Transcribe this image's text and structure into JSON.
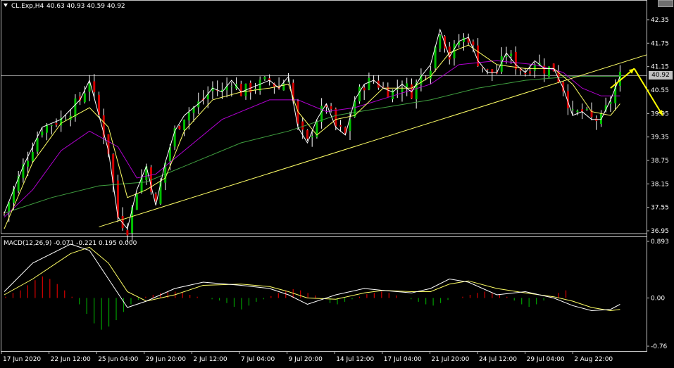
{
  "header": {
    "symbol": "CL.Exp,H4",
    "ohlc": "40.63 40.93 40.59 40.92"
  },
  "current_price_label": "40.92",
  "macd": {
    "label": "MACD(12,26,9)",
    "values": "-0.071 -0.221 0.195 0.000"
  },
  "colors": {
    "bull": "#00c000",
    "bear": "#d40000",
    "wick": "#ffffff",
    "fast_ma": "#ffffff",
    "mid_ma": "#ffff66",
    "slow_ma": "#b000d0",
    "long_ma": "#40a040",
    "trendline": "#ffff66",
    "arrow": "#ffff00",
    "macd_line": "#ffffff",
    "signal_line": "#ffff66",
    "hist_pos": "#d40000",
    "hist_neg": "#00a000"
  },
  "chart_data": [
    {
      "type": "candlestick",
      "title": "CL.Exp,H4",
      "y_ticks": [
        "42.35",
        "41.75",
        "41.15",
        "40.55",
        "39.95",
        "39.35",
        "38.75",
        "38.15",
        "37.55",
        "36.95"
      ],
      "ylim": [
        36.9,
        42.5
      ],
      "x_ticks": [
        "17 Jun 2020",
        "22 Jun 12:00",
        "25 Jun 04:00",
        "29 Jun 20:00",
        "2 Jul 12:00",
        "7 Jul 04:00",
        "9 Jul 20:00",
        "14 Jul 12:00",
        "17 Jul 04:00",
        "21 Jul 20:00",
        "24 Jul 12:00",
        "29 Jul 04:00",
        "2 Aug 22:00"
      ],
      "current_price": 40.92,
      "close_path": [
        [
          0,
          37.4
        ],
        [
          4,
          38.6
        ],
        [
          8,
          39.6
        ],
        [
          12,
          39.8
        ],
        [
          16,
          40.3
        ],
        [
          18,
          40.8
        ],
        [
          20,
          39.9
        ],
        [
          22,
          39.0
        ],
        [
          24,
          37.3
        ],
        [
          26,
          37.0
        ],
        [
          28,
          38.0
        ],
        [
          30,
          38.6
        ],
        [
          32,
          37.6
        ],
        [
          34,
          38.7
        ],
        [
          36,
          39.5
        ],
        [
          38,
          39.9
        ],
        [
          40,
          40.1
        ],
        [
          42,
          40.3
        ],
        [
          44,
          40.6
        ],
        [
          46,
          40.5
        ],
        [
          48,
          40.8
        ],
        [
          50,
          40.5
        ],
        [
          52,
          40.6
        ],
        [
          54,
          40.7
        ],
        [
          56,
          40.8
        ],
        [
          58,
          40.6
        ],
        [
          60,
          40.9
        ],
        [
          62,
          39.6
        ],
        [
          64,
          39.2
        ],
        [
          66,
          39.8
        ],
        [
          68,
          40.2
        ],
        [
          70,
          39.6
        ],
        [
          72,
          39.4
        ],
        [
          74,
          40.3
        ],
        [
          76,
          40.7
        ],
        [
          78,
          40.8
        ],
        [
          80,
          40.6
        ],
        [
          82,
          40.5
        ],
        [
          84,
          40.7
        ],
        [
          86,
          40.5
        ],
        [
          88,
          40.9
        ],
        [
          90,
          41.2
        ],
        [
          92,
          42.1
        ],
        [
          94,
          41.4
        ],
        [
          96,
          41.8
        ],
        [
          98,
          41.9
        ],
        [
          100,
          41.3
        ],
        [
          102,
          41.0
        ],
        [
          104,
          41.0
        ],
        [
          106,
          41.5
        ],
        [
          108,
          41.2
        ],
        [
          110,
          41.0
        ],
        [
          112,
          41.3
        ],
        [
          114,
          41.1
        ],
        [
          116,
          41.1
        ],
        [
          118,
          40.6
        ],
        [
          120,
          39.9
        ],
        [
          122,
          40.0
        ],
        [
          124,
          39.8
        ],
        [
          126,
          39.8
        ],
        [
          128,
          40.3
        ],
        [
          130,
          40.9
        ]
      ],
      "moving_average_points": {
        "mid": [
          [
            0,
            37.0
          ],
          [
            6,
            38.7
          ],
          [
            12,
            39.7
          ],
          [
            18,
            40.1
          ],
          [
            22,
            39.6
          ],
          [
            26,
            37.8
          ],
          [
            30,
            38.0
          ],
          [
            34,
            38.3
          ],
          [
            38,
            39.5
          ],
          [
            44,
            40.3
          ],
          [
            50,
            40.5
          ],
          [
            56,
            40.6
          ],
          [
            60,
            40.7
          ],
          [
            62,
            40.0
          ],
          [
            66,
            39.4
          ],
          [
            70,
            39.8
          ],
          [
            74,
            39.9
          ],
          [
            80,
            40.6
          ],
          [
            86,
            40.6
          ],
          [
            90,
            40.9
          ],
          [
            94,
            41.5
          ],
          [
            98,
            41.7
          ],
          [
            104,
            41.2
          ],
          [
            110,
            41.1
          ],
          [
            116,
            41.1
          ],
          [
            120,
            40.7
          ],
          [
            124,
            40.0
          ],
          [
            128,
            39.9
          ],
          [
            130,
            40.2
          ]
        ],
        "slow": [
          [
            0,
            37.3
          ],
          [
            6,
            38.0
          ],
          [
            12,
            39.0
          ],
          [
            18,
            39.5
          ],
          [
            24,
            39.1
          ],
          [
            28,
            38.3
          ],
          [
            32,
            38.4
          ],
          [
            38,
            39.0
          ],
          [
            46,
            39.8
          ],
          [
            56,
            40.3
          ],
          [
            62,
            40.3
          ],
          [
            68,
            40.0
          ],
          [
            74,
            40.1
          ],
          [
            82,
            40.4
          ],
          [
            90,
            40.7
          ],
          [
            96,
            41.2
          ],
          [
            104,
            41.3
          ],
          [
            112,
            41.2
          ],
          [
            118,
            41.0
          ],
          [
            122,
            40.6
          ],
          [
            126,
            40.4
          ],
          [
            130,
            40.4
          ]
        ],
        "long": [
          [
            0,
            37.4
          ],
          [
            10,
            37.8
          ],
          [
            20,
            38.1
          ],
          [
            30,
            38.2
          ],
          [
            40,
            38.7
          ],
          [
            50,
            39.2
          ],
          [
            60,
            39.5
          ],
          [
            70,
            39.9
          ],
          [
            80,
            40.1
          ],
          [
            90,
            40.3
          ],
          [
            100,
            40.6
          ],
          [
            110,
            40.8
          ],
          [
            120,
            40.9
          ],
          [
            130,
            40.9
          ]
        ]
      },
      "trendline": [
        [
          20,
          37.05
        ],
        [
          150,
          42.0
        ]
      ],
      "forecast_arrow": [
        [
          128,
          40.6
        ],
        [
          133,
          41.1
        ],
        [
          139,
          39.9
        ]
      ]
    },
    {
      "type": "bar",
      "title": "MACD(12,26,9)",
      "y_ticks": [
        "0.893",
        "0.00",
        "-0.76"
      ],
      "ylim": [
        -0.8,
        0.93
      ],
      "histogram": [
        0.02,
        0.08,
        0.12,
        0.2,
        0.28,
        0.34,
        0.3,
        0.22,
        0.12,
        0.02,
        -0.1,
        -0.25,
        -0.4,
        -0.5,
        -0.45,
        -0.35,
        -0.22,
        -0.1,
        -0.03,
        0.02,
        0.05,
        0.08,
        0.1,
        0.1,
        0.08,
        0.05,
        0.02,
        0.0,
        -0.02,
        -0.04,
        -0.08,
        -0.14,
        -0.18,
        -0.12,
        -0.06,
        -0.02,
        0.03,
        0.08,
        0.12,
        0.14,
        0.12,
        0.08,
        0.04,
        -0.02,
        -0.08,
        -0.1,
        -0.06,
        -0.02,
        0.02,
        0.06,
        0.08,
        0.1,
        0.08,
        0.04,
        0.0,
        -0.02,
        -0.06,
        -0.1,
        -0.12,
        -0.08,
        -0.03,
        0.0,
        0.02,
        0.05,
        0.08,
        0.1,
        0.08,
        0.05,
        0.02,
        -0.04,
        -0.1,
        -0.14,
        -0.1,
        -0.04,
        0.02,
        0.08,
        0.12
      ],
      "macd_line": [
        [
          0,
          0.1
        ],
        [
          6,
          0.55
        ],
        [
          14,
          0.85
        ],
        [
          18,
          0.75
        ],
        [
          22,
          0.3
        ],
        [
          26,
          -0.15
        ],
        [
          30,
          -0.05
        ],
        [
          36,
          0.15
        ],
        [
          42,
          0.25
        ],
        [
          50,
          0.2
        ],
        [
          56,
          0.15
        ],
        [
          60,
          0.05
        ],
        [
          64,
          -0.1
        ],
        [
          70,
          0.05
        ],
        [
          76,
          0.15
        ],
        [
          80,
          0.12
        ],
        [
          86,
          0.08
        ],
        [
          90,
          0.15
        ],
        [
          94,
          0.3
        ],
        [
          98,
          0.25
        ],
        [
          104,
          0.05
        ],
        [
          110,
          0.1
        ],
        [
          116,
          0.0
        ],
        [
          120,
          -0.12
        ],
        [
          124,
          -0.2
        ],
        [
          128,
          -0.18
        ],
        [
          130,
          -0.1
        ]
      ],
      "signal_line": [
        [
          0,
          0.05
        ],
        [
          6,
          0.3
        ],
        [
          14,
          0.7
        ],
        [
          18,
          0.8
        ],
        [
          22,
          0.55
        ],
        [
          26,
          0.1
        ],
        [
          30,
          -0.05
        ],
        [
          36,
          0.05
        ],
        [
          42,
          0.2
        ],
        [
          50,
          0.22
        ],
        [
          56,
          0.18
        ],
        [
          60,
          0.1
        ],
        [
          64,
          0.0
        ],
        [
          70,
          -0.02
        ],
        [
          76,
          0.08
        ],
        [
          80,
          0.12
        ],
        [
          86,
          0.1
        ],
        [
          90,
          0.1
        ],
        [
          94,
          0.22
        ],
        [
          98,
          0.27
        ],
        [
          104,
          0.15
        ],
        [
          110,
          0.08
        ],
        [
          116,
          0.02
        ],
        [
          120,
          -0.05
        ],
        [
          124,
          -0.15
        ],
        [
          128,
          -0.2
        ],
        [
          130,
          -0.18
        ]
      ]
    }
  ]
}
